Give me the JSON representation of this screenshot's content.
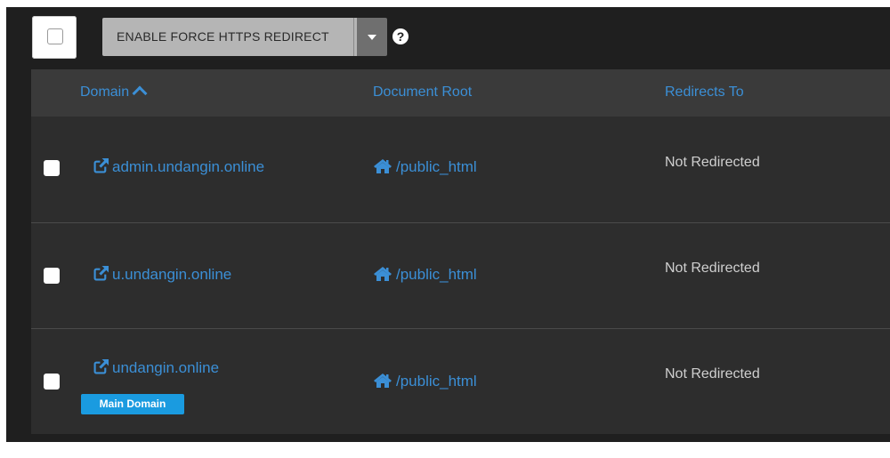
{
  "toolbar": {
    "bulk_action_label": "ENABLE FORCE HTTPS REDIRECT",
    "help_symbol": "?"
  },
  "table": {
    "columns": {
      "domain": "Domain",
      "document_root": "Document Root",
      "redirects_to": "Redirects To"
    },
    "sort": {
      "column": "domain",
      "direction": "ascending"
    },
    "rows": [
      {
        "domain": "admin.undangin.online",
        "document_root": "/public_html",
        "redirects_to": "Not Redirected",
        "badge": ""
      },
      {
        "domain": "u.undangin.online",
        "document_root": "/public_html",
        "redirects_to": "Not Redirected",
        "badge": ""
      },
      {
        "domain": "undangin.online",
        "document_root": "/public_html",
        "redirects_to": "Not Redirected",
        "badge": "Main Domain"
      }
    ]
  },
  "icons": {
    "domain_link": "external-link-icon",
    "document_root": "home-icon",
    "sort": "chevron-up-icon",
    "help": "question-circle-icon",
    "dropdown": "caret-down-icon"
  },
  "colors": {
    "link": "#3b8fd6",
    "badge": "#1a9be0",
    "header_bg": "#3a3a3a",
    "row_bg": "#2d2d2d",
    "page_bg": "#1f1f1f"
  }
}
